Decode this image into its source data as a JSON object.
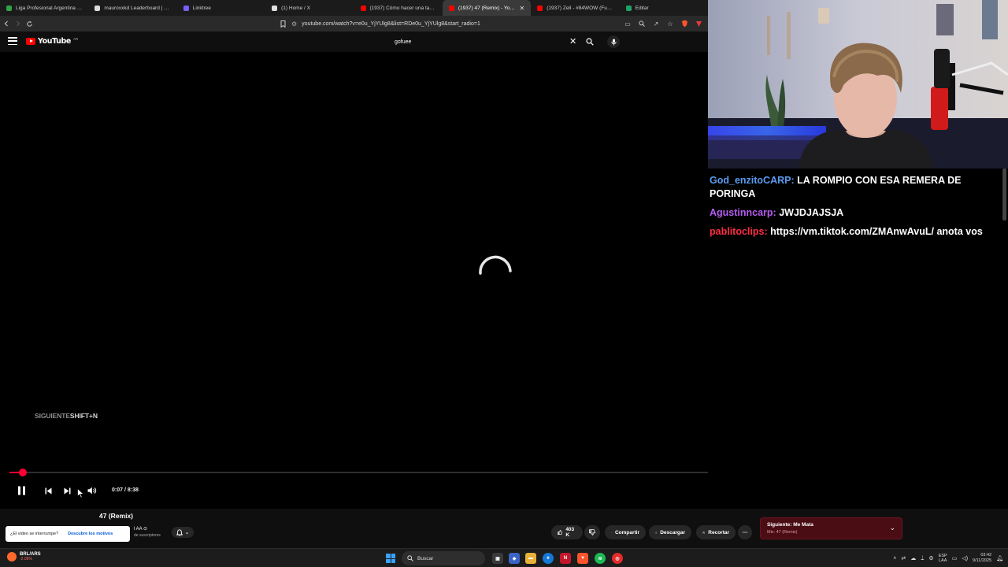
{
  "browser": {
    "tabs": [
      {
        "label": "Liga Profesional Argentina - POSICIO",
        "favicon_color": "#2fa34a",
        "active": false
      },
      {
        "label": "mauroxxkd Leaderboard | The best C",
        "favicon_color": "#dddddd",
        "active": false
      },
      {
        "label": "Linktree",
        "favicon_color": "#7a5cff",
        "active": false
      },
      {
        "label": "(1) Home / X",
        "favicon_color": "#e0e0e0",
        "active": false
      },
      {
        "label": "(1937) Cómo hacer una tabla en Exce",
        "favicon_color": "#ff0000",
        "active": false
      },
      {
        "label": "(1937) 47 (Remix) - YouTube",
        "favicon_color": "#ff0000",
        "active": true,
        "close": "✕"
      },
      {
        "label": "(1937) Zell - #84WOW (Full Mixtape)",
        "favicon_color": "#ff0000",
        "active": false
      },
      {
        "label": "Editar",
        "favicon_color": "#1fa463",
        "active": false
      }
    ],
    "url": "youtube.com/watch?v=e0u_YjYUlg8&list=RDe0u_YjYUlg8&start_radio=1"
  },
  "youtube": {
    "logo_text": "YouTube",
    "country_code": "AR",
    "search_query": "gofuee",
    "brand_color": "#ff0000"
  },
  "player": {
    "next_hint_label": "SIGUIENTE",
    "next_hint_key": "SHIFT+N",
    "current_time": "0:07",
    "duration": "8:38",
    "time_display": "0:07 / 8:38",
    "progress_fraction": 0.0135,
    "accent_color": "#ff0033"
  },
  "video": {
    "title": "47 (Remix)",
    "channel_fragment": "l AA ⊙",
    "subscribers_fragment": "de suscriptores",
    "interrupt_question": "¿El video se interrumpe?",
    "interrupt_link": "Descubre los motivos",
    "likes": "403 K",
    "share_label": "Compartir",
    "download_label": "Descargar",
    "clip_label": "Recortar",
    "more_label": "⋯"
  },
  "up_next": {
    "title": "Siguiente: Me Mata",
    "subtitle": "Mix: 47 (Remix)"
  },
  "taskbar": {
    "stock_name": "BRL/ARS",
    "stock_change": "-2.05%",
    "search_label": "Buscar",
    "lang_top": "ESP",
    "lang_bottom": "LAA",
    "clock_time": "03:42",
    "clock_date": "9/11/2025"
  },
  "chat": {
    "messages": [
      {
        "user": "God_enzitoCARP:",
        "text": "LA ROMPIO CON ESA REMERA DE PORINGA",
        "color": "#5b9bf0"
      },
      {
        "user": "Agustinncarp:",
        "text": "JWJDJAJSJA",
        "color": "#b65cf0"
      },
      {
        "user": "pablitoclips:",
        "text": "https://vm.tiktok.com/ZMAnwAvuL/ anota vos",
        "color": "#ff2e45"
      }
    ]
  }
}
